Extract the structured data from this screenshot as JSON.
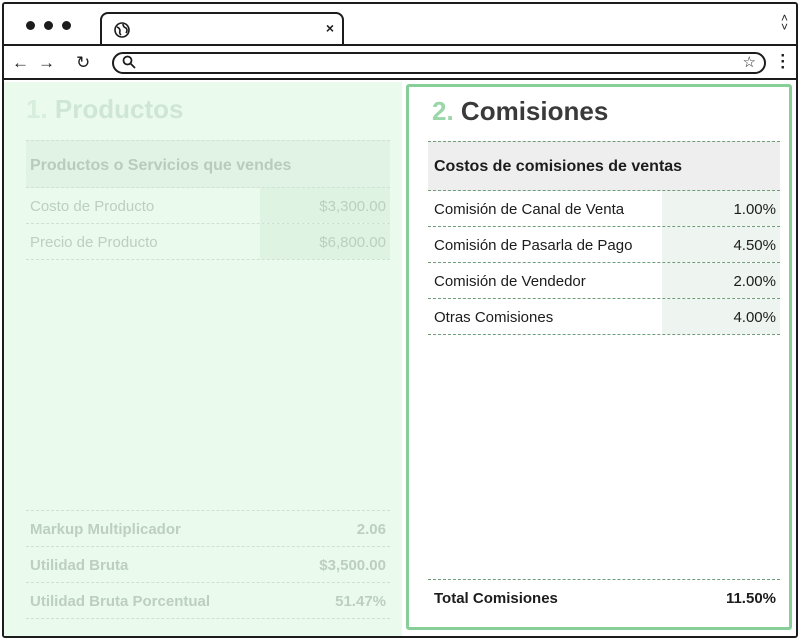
{
  "browser": {
    "tab_close": "×",
    "icons": [
      "globe-icon",
      "search-icon",
      "star-icon",
      "back-arrow-icon",
      "forward-arrow-icon",
      "reload-icon",
      "kebab-menu-icon"
    ]
  },
  "products": {
    "step": "1.",
    "title": "Productos",
    "header": "Productos o Servicios que vendes",
    "rows": [
      {
        "label": "Costo de Producto",
        "value": "$3,300.00"
      },
      {
        "label": "Precio de Producto",
        "value": "$6,800.00"
      }
    ],
    "summary": [
      {
        "label": "Markup Multiplicador",
        "value": "2.06"
      },
      {
        "label": "Utilidad Bruta",
        "value": "$3,500.00"
      },
      {
        "label": "Utilidad Bruta Porcentual",
        "value": "51.47%"
      }
    ]
  },
  "commissions": {
    "step": "2.",
    "title": "Comisiones",
    "header": "Costos de comisiones de ventas",
    "rows": [
      {
        "label": "Comisión de Canal de Venta",
        "value": "1.00%"
      },
      {
        "label": "Comisión de Pasarla de Pago",
        "value": "4.50%"
      },
      {
        "label": "Comisión de Vendedor",
        "value": "2.00%"
      },
      {
        "label": "Otras Comisiones",
        "value": "4.00%"
      }
    ],
    "total": {
      "label": "Total Comisiones",
      "value": "11.50%"
    }
  },
  "colors": {
    "accent_border": "#86cf98",
    "left_panel_bg": "#eafaed"
  }
}
